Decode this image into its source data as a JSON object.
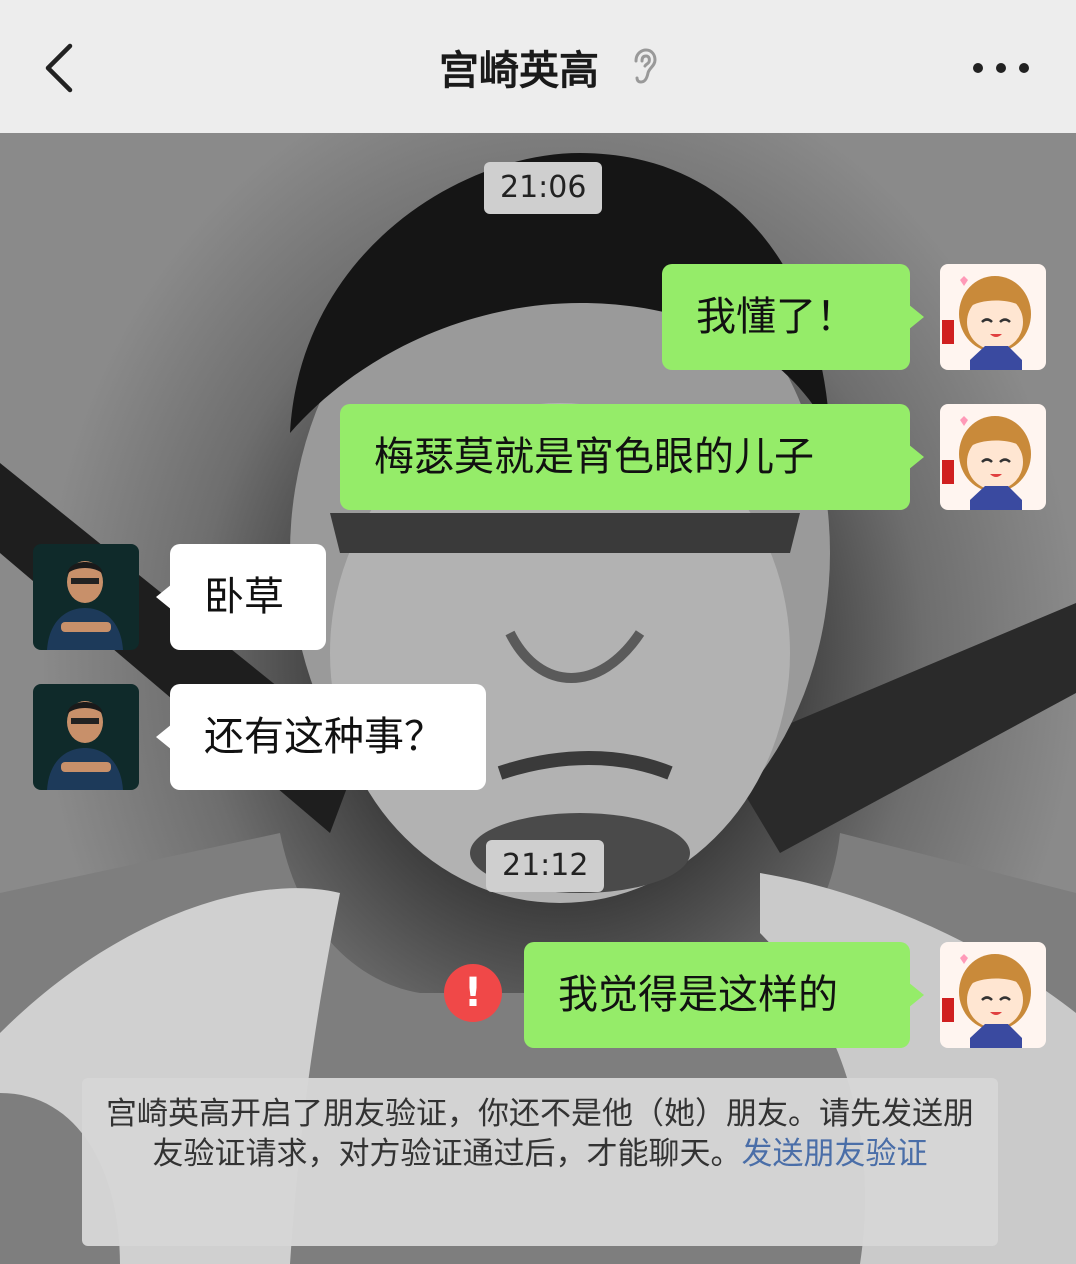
{
  "header": {
    "title": "宫崎英高"
  },
  "icons": {
    "back": "chevron-left-icon",
    "ear": "ear-icon",
    "more": "more-icon",
    "error": "error-icon"
  },
  "colors": {
    "header_bg": "#ededed",
    "bubble_me": "#95ec69",
    "bubble_them": "#ffffff",
    "error": "#f04848",
    "link": "#4a6ea8"
  },
  "messages": [
    {
      "type": "time",
      "text": "21:06"
    },
    {
      "type": "me",
      "text": "我懂了！"
    },
    {
      "type": "me",
      "text": "梅瑟莫就是宵色眼的儿子"
    },
    {
      "type": "them",
      "text": "卧草"
    },
    {
      "type": "them",
      "text": "还有这种事？"
    },
    {
      "type": "time",
      "text": "21:12"
    },
    {
      "type": "me",
      "text": "我觉得是这样的",
      "status": "!"
    }
  ],
  "notice": {
    "text": "宫崎英高开启了朋友验证，你还不是他（她）朋友。请先发送朋友验证请求，对方验证通过后，才能聊天。",
    "link": "发送朋友验证"
  }
}
